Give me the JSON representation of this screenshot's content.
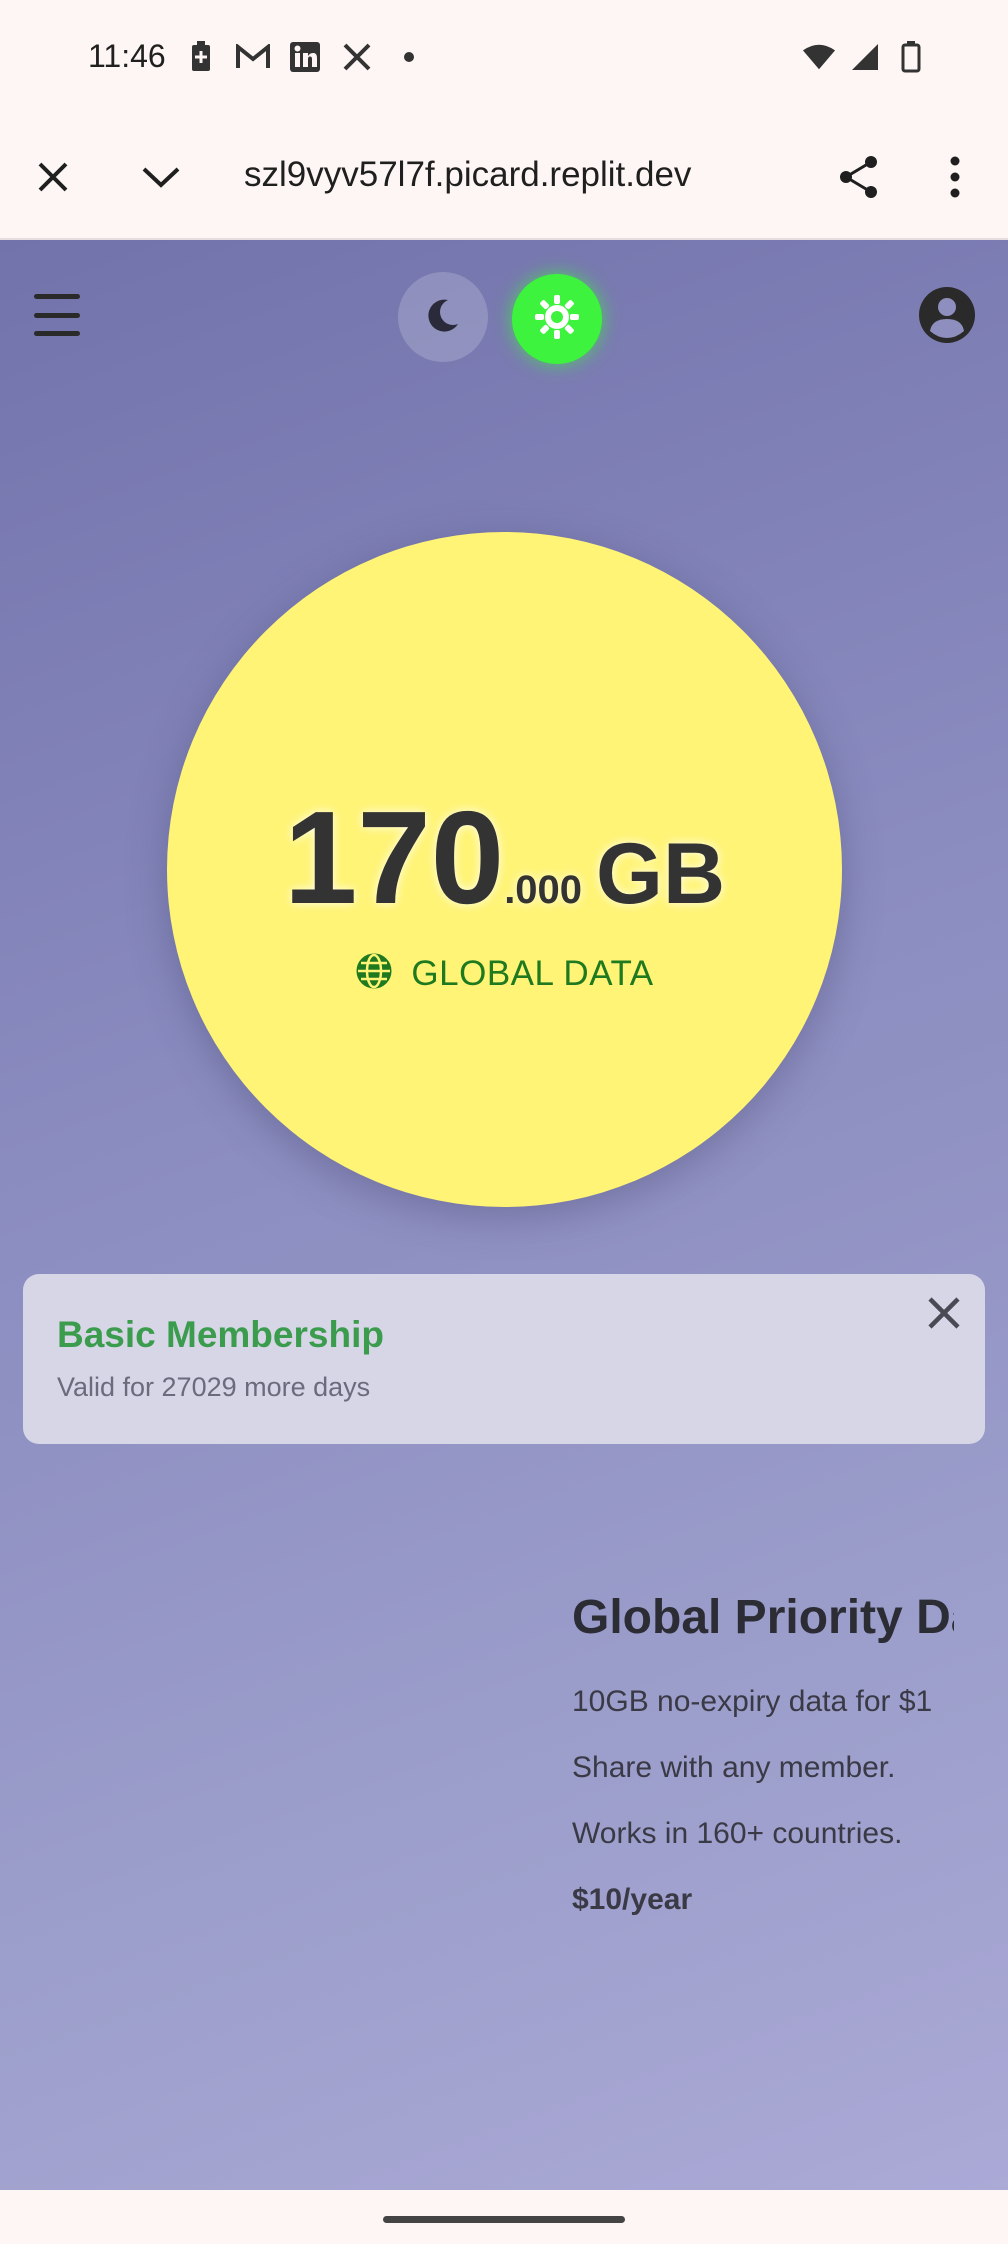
{
  "status_bar": {
    "time": "11:46",
    "left_icons": [
      "battery-saver-icon",
      "gmail-icon",
      "linkedin-icon",
      "x-icon",
      "dot-icon"
    ],
    "right_icons": [
      "wifi-icon",
      "signal-icon",
      "battery-icon"
    ]
  },
  "browser": {
    "url": "szl9vyv57l7f.picard.replit.dev",
    "close_icon": "close-icon",
    "dropdown_icon": "chevron-down-icon",
    "share_icon": "share-icon",
    "menu_icon": "more-vert-icon"
  },
  "header": {
    "menu_icon": "hamburger-icon",
    "dark_mode_icon": "moon-icon",
    "light_mode_icon": "sun-icon",
    "light_mode_color": "#3df33e",
    "account_icon": "account-circle-icon"
  },
  "data_balance": {
    "integer": "170",
    "decimal": ".000",
    "unit": "GB",
    "label": "GLOBAL DATA",
    "circle_color": "#fff475",
    "label_color": "#1f7a1f"
  },
  "membership": {
    "title": "Basic Membership",
    "subtitle": "Valid for 27029 more days",
    "title_color": "#3c9c4d"
  },
  "offer": {
    "title": "Global Priority Da",
    "line1": "10GB no-expiry data for $1",
    "line2": "Share with any member.",
    "line3": "Works in 160+ countries.",
    "price": "$10/year"
  }
}
